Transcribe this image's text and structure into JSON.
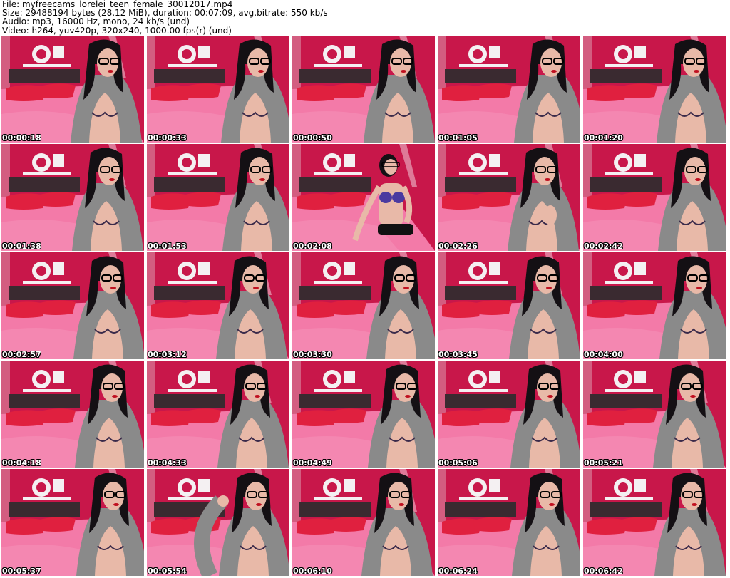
{
  "header": {
    "file_line": "File: myfreecams_lorelei_teen_female_30012017.mp4",
    "size_line": "Size: 29488194 bytes (28.12 MiB), duration: 00:07:09, avg.bitrate: 550 kb/s",
    "audio_line": "Audio: mp3, 16000 Hz, mono, 24 kb/s (und)",
    "video_line": "Video: h264, yuv420p, 320x240, 1000.00 fps(r) (und)"
  },
  "thumbnails": [
    {
      "time": "00:00:18",
      "pose": "seated"
    },
    {
      "time": "00:00:33",
      "pose": "seated"
    },
    {
      "time": "00:00:50",
      "pose": "seated"
    },
    {
      "time": "00:01:05",
      "pose": "seated"
    },
    {
      "time": "00:01:20",
      "pose": "seated"
    },
    {
      "time": "00:01:38",
      "pose": "seated"
    },
    {
      "time": "00:01:53",
      "pose": "seated"
    },
    {
      "time": "00:02:08",
      "pose": "leaning-back"
    },
    {
      "time": "00:02:26",
      "pose": "hand-raised"
    },
    {
      "time": "00:02:42",
      "pose": "seated"
    },
    {
      "time": "00:02:57",
      "pose": "seated"
    },
    {
      "time": "00:03:12",
      "pose": "seated"
    },
    {
      "time": "00:03:30",
      "pose": "seated"
    },
    {
      "time": "00:03:45",
      "pose": "seated"
    },
    {
      "time": "00:04:00",
      "pose": "seated"
    },
    {
      "time": "00:04:18",
      "pose": "seated"
    },
    {
      "time": "00:04:33",
      "pose": "seated"
    },
    {
      "time": "00:04:49",
      "pose": "seated"
    },
    {
      "time": "00:05:06",
      "pose": "seated"
    },
    {
      "time": "00:05:21",
      "pose": "seated"
    },
    {
      "time": "00:05:37",
      "pose": "seated"
    },
    {
      "time": "00:05:54",
      "pose": "arm-up"
    },
    {
      "time": "00:06:10",
      "pose": "seated"
    },
    {
      "time": "00:06:24",
      "pose": "seated"
    },
    {
      "time": "00:06:42",
      "pose": "seated"
    }
  ],
  "colors": {
    "wall": "#c8174a",
    "bed": "#f37aa8",
    "pillow": "#e0203f",
    "cardigan": "#8a8a8a",
    "hair": "#141014",
    "skin": "#e8b9a8"
  }
}
